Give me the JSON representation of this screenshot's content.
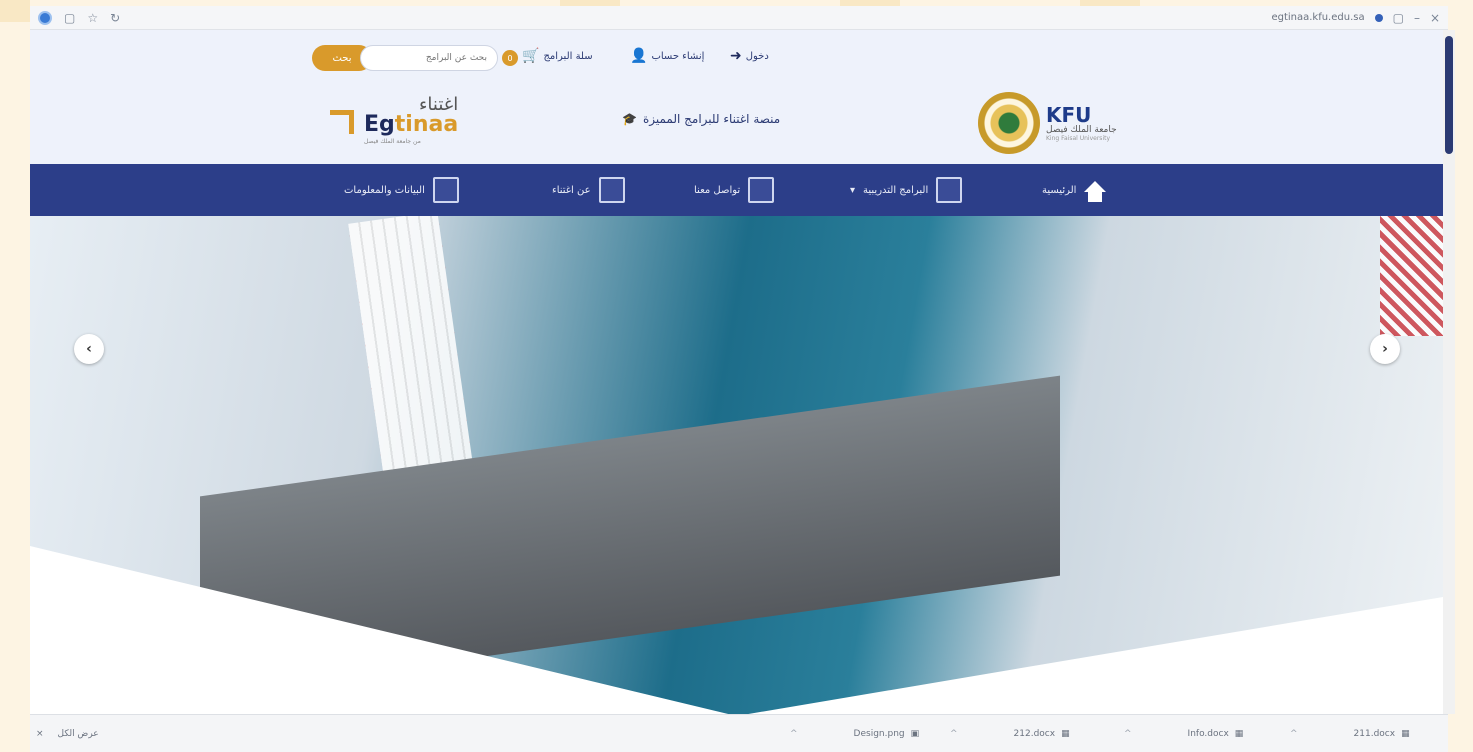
{
  "browser": {
    "url": "egtinaa.kfu.edu.sa",
    "icons": [
      "kfu-dot-icon",
      "tab-icon",
      "star-icon",
      "refresh-icon"
    ]
  },
  "topbar": {
    "login_label": "دخول",
    "register_label": "إنشاء حساب",
    "cart_label": "سلة البرامج",
    "cart_count": "0",
    "search_placeholder": "بحث عن البرامج",
    "search_button": "بحث"
  },
  "brand": {
    "egtinaa_ar": "اغتناء",
    "egtinaa_en_prefix": "Eg",
    "egtinaa_en_suffix": "tinaa",
    "egtinaa_sub": "من جامعة الملك فيصل",
    "platform_title": "منصة اغتناء للبرامج المميزة",
    "kfu_en": "KFU",
    "kfu_ar": "جامعة الملك فيصل",
    "kfu_ar2": "King Faisal University"
  },
  "nav": {
    "items": [
      {
        "label": "الرئيسية",
        "icon": "home-icon"
      },
      {
        "label": "البرامج التدريبية",
        "icon": "programs-icon"
      },
      {
        "label": "تواصل معنا",
        "icon": "contact-icon"
      },
      {
        "label": "عن اغتناء",
        "icon": "about-icon"
      },
      {
        "label": "البيانات والمعلومات",
        "icon": "data-icon"
      }
    ]
  },
  "hero": {
    "prev_glyph": "‹",
    "next_glyph": "›"
  },
  "downloads": {
    "show_all": "عرض الكل",
    "files": [
      {
        "name": "Design.png",
        "size": ""
      },
      {
        "name": "212.docx",
        "size": ""
      },
      {
        "name": "Info.docx",
        "size": ""
      },
      {
        "name": "211.docx",
        "size": ""
      }
    ]
  },
  "colors": {
    "nav_bg": "#2c3e89",
    "accent_gold": "#d99a2b",
    "header_bg": "#eef2fb"
  }
}
